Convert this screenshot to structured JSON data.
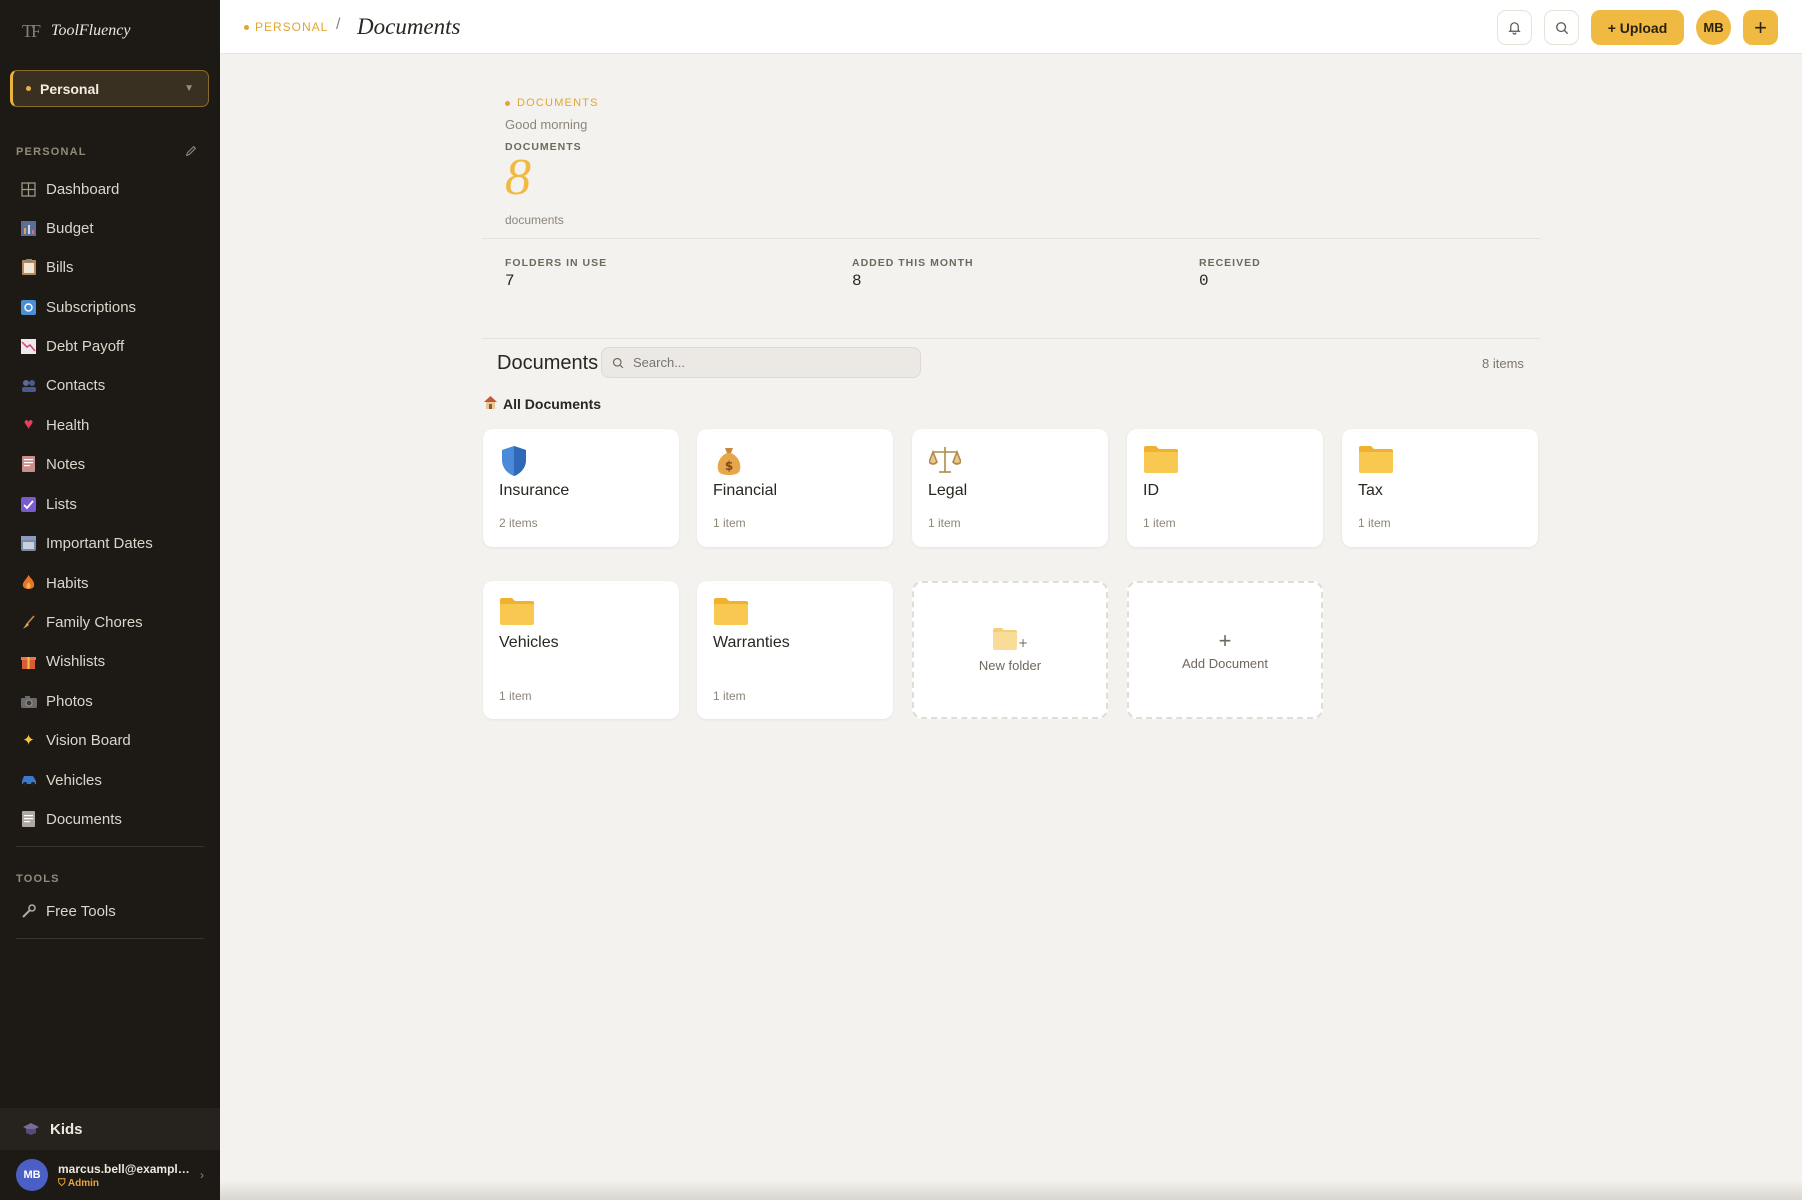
{
  "brand": {
    "mark": "TF",
    "name": "ToolFluency"
  },
  "workspace": {
    "name": "Personal"
  },
  "sidebar": {
    "section_personal": "PERSONAL",
    "items": [
      {
        "label": "Dashboard",
        "icon": "grid-icon"
      },
      {
        "label": "Budget",
        "icon": "chart-icon"
      },
      {
        "label": "Bills",
        "icon": "clipboard-icon"
      },
      {
        "label": "Subscriptions",
        "icon": "refresh-icon"
      },
      {
        "label": "Debt Payoff",
        "icon": "trend-down-icon"
      },
      {
        "label": "Contacts",
        "icon": "people-icon"
      },
      {
        "label": "Health",
        "icon": "heart-icon"
      },
      {
        "label": "Notes",
        "icon": "page-icon"
      },
      {
        "label": "Lists",
        "icon": "check-icon"
      },
      {
        "label": "Important Dates",
        "icon": "calendar-icon"
      },
      {
        "label": "Habits",
        "icon": "flame-icon"
      },
      {
        "label": "Family Chores",
        "icon": "broom-icon"
      },
      {
        "label": "Wishlists",
        "icon": "gift-icon"
      },
      {
        "label": "Photos",
        "icon": "camera-icon"
      },
      {
        "label": "Vision Board",
        "icon": "sparkle-icon"
      },
      {
        "label": "Vehicles",
        "icon": "car-icon"
      },
      {
        "label": "Documents",
        "icon": "document-icon"
      }
    ],
    "section_tools": "TOOLS",
    "tools": [
      {
        "label": "Free Tools",
        "icon": "wrench-icon"
      }
    ],
    "kids_label": "Kids",
    "user": {
      "initials": "MB",
      "email": "marcus.bell@example.com",
      "role": "Admin"
    }
  },
  "topbar": {
    "breadcrumb_ws": "PERSONAL",
    "separator": "/",
    "title": "Documents",
    "upload_label": "+ Upload",
    "avatar_initials": "MB",
    "plus_label": "+"
  },
  "summary": {
    "eyebrow": "DOCUMENTS",
    "greeting": "Good morning",
    "label": "DOCUMENTS",
    "count": "8",
    "unit": "documents",
    "stats": [
      {
        "label": "FOLDERS IN USE",
        "value": "7"
      },
      {
        "label": "ADDED THIS MONTH",
        "value": "8"
      },
      {
        "label": "RECEIVED",
        "value": "0"
      }
    ]
  },
  "library": {
    "title": "Documents",
    "search_placeholder": "Search...",
    "item_count": "8 items",
    "breadcrumb": "All Documents",
    "folders": [
      {
        "name": "Insurance",
        "count": "2 items",
        "icon": "shield-icon"
      },
      {
        "name": "Financial",
        "count": "1 item",
        "icon": "money-bag-icon"
      },
      {
        "name": "Legal",
        "count": "1 item",
        "icon": "scales-icon"
      },
      {
        "name": "ID",
        "count": "1 item",
        "icon": "folder-icon"
      },
      {
        "name": "Tax",
        "count": "1 item",
        "icon": "folder-icon"
      },
      {
        "name": "Vehicles",
        "count": "1 item",
        "icon": "folder-icon"
      },
      {
        "name": "Warranties",
        "count": "1 item",
        "icon": "folder-icon"
      }
    ],
    "new_folder_label": "New folder",
    "add_document_label": "Add Document",
    "add_document_icon": "+"
  },
  "colors": {
    "accent": "#f0b942",
    "sidebar_bg": "#1d1a16",
    "page_bg": "#f4f2ee"
  }
}
